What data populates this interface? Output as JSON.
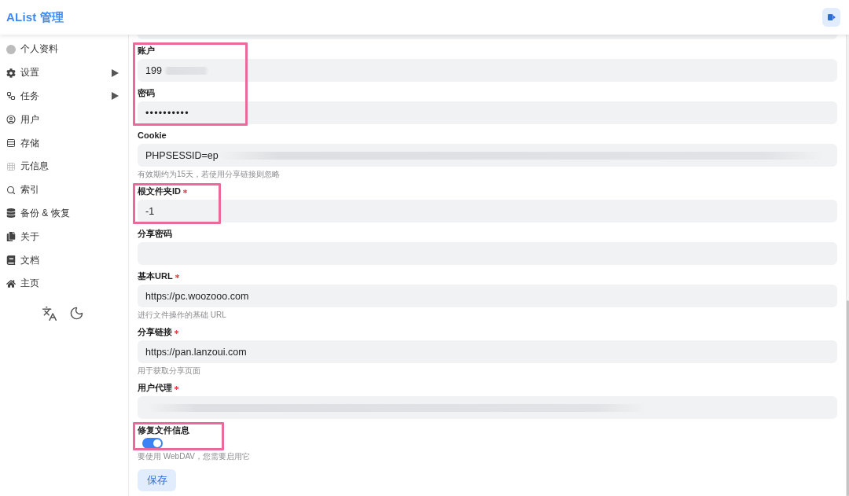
{
  "header": {
    "title": "AList 管理"
  },
  "sidebar": {
    "items": [
      {
        "label": "个人资料",
        "kind": "link"
      },
      {
        "label": "设置",
        "kind": "group",
        "expanded": false
      },
      {
        "label": "任务",
        "kind": "group",
        "expanded": false
      },
      {
        "label": "用户",
        "kind": "link"
      },
      {
        "label": "存储",
        "kind": "link"
      },
      {
        "label": "元信息",
        "kind": "link"
      },
      {
        "label": "索引",
        "kind": "link"
      },
      {
        "label": "备份 & 恢复",
        "kind": "link"
      },
      {
        "label": "关于",
        "kind": "link"
      },
      {
        "label": "文档",
        "kind": "link"
      },
      {
        "label": "主页",
        "kind": "link"
      }
    ]
  },
  "form": {
    "fields": [
      {
        "kind": "input-partial",
        "highlighted": false
      },
      {
        "kind": "input",
        "label": "账户",
        "value": "199",
        "required": false,
        "redacted": true,
        "highlighted": true
      },
      {
        "kind": "input",
        "label": "密码",
        "value": "••••••••••",
        "required": false,
        "redacted": false,
        "highlighted": true
      },
      {
        "kind": "input",
        "label": "Cookie",
        "value": "PHPSESSID=ep",
        "required": false,
        "redacted": true,
        "highlighted": false,
        "hint": "有效期约为15天，若使用分享链接则忽略"
      },
      {
        "kind": "input",
        "label": "根文件夹ID",
        "value": "-1",
        "required": true,
        "redacted": false,
        "highlighted": true
      },
      {
        "kind": "input",
        "label": "分享密码",
        "required": false,
        "redacted": false,
        "highlighted": false
      },
      {
        "kind": "input",
        "label": "基本URL",
        "value": "https://pc.woozooo.com",
        "required": true,
        "redacted": false,
        "highlighted": false,
        "hint": "进行文件操作的基础 URL"
      },
      {
        "kind": "input",
        "label": "分享链接",
        "value": "https://pan.lanzoui.com",
        "required": true,
        "redacted": false,
        "highlighted": false,
        "hint": "用于获取分享页面"
      },
      {
        "kind": "input",
        "label": "用户代理",
        "required": true,
        "redacted": true,
        "highlighted": false
      },
      {
        "kind": "switch",
        "label": "修复文件信息",
        "on": true,
        "required": false,
        "highlighted": true,
        "hint": "要使用 WebDAV，您需要启用它"
      }
    ],
    "submit": {
      "label": "保存"
    }
  }
}
